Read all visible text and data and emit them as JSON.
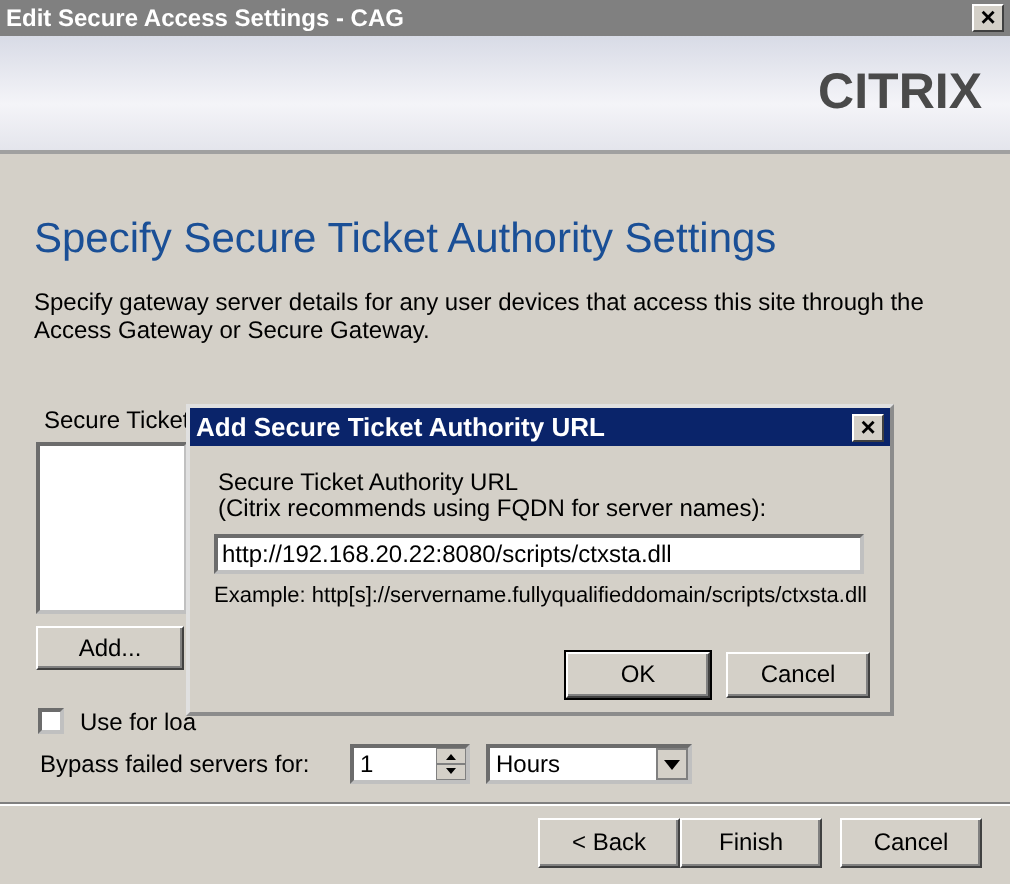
{
  "window": {
    "title": "Edit Secure Access Settings - CAG",
    "close": "×"
  },
  "logo": "CITRIX",
  "heading": "Specify Secure Ticket Authority Settings",
  "description": "Specify gateway server details for any user devices that access this site through the Access Gateway or Secure Gateway.",
  "sta_list": {
    "label": "Secure Ticket"
  },
  "add_button": "Add...",
  "load_balancing": {
    "label": "Use for loa",
    "checked": false
  },
  "bypass": {
    "label": "Bypass failed servers for:",
    "value": "1",
    "unit": "Hours"
  },
  "buttons": [
    {
      "label": "< Back"
    },
    {
      "label": "Finish"
    },
    {
      "label": "Cancel"
    }
  ],
  "dialog": {
    "title": "Add Secure Ticket Authority URL",
    "close": "×",
    "prompt": "Secure Ticket Authority URL",
    "hint": "(Citrix recommends using FQDN for server names):",
    "url": "http://192.168.20.22:8080/scripts/ctxsta.dll",
    "example": "Example: http[s]://servername.fullyqualifieddomain/scripts/ctxsta.dll",
    "buttons": [
      {
        "label": "OK"
      },
      {
        "label": "Cancel"
      }
    ]
  }
}
